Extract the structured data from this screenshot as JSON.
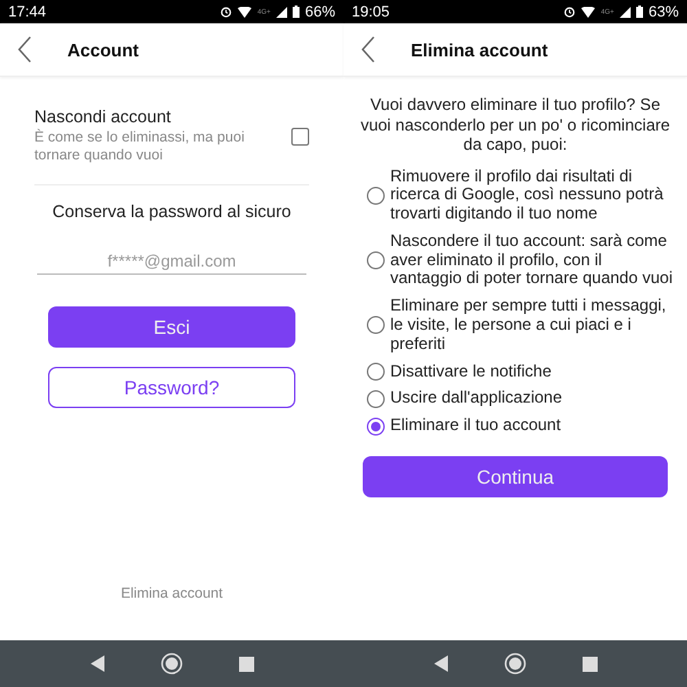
{
  "screens": [
    {
      "kind": "account",
      "status": {
        "time": "17:44",
        "network": "4G+",
        "battery": "66%"
      },
      "title": "Account",
      "hide_option": {
        "label": "Nascondi account",
        "description": "È come se lo eliminassi, ma puoi tornare quando vuoi",
        "checked": false
      },
      "password_note": "Conserva la password al sicuro",
      "email_field": {
        "value": "f*****@gmail.com"
      },
      "buttons": [
        {
          "label": "Esci",
          "kind": "primary"
        },
        {
          "label": "Password?",
          "kind": "outline"
        }
      ],
      "footer_link": "Elimina account"
    },
    {
      "kind": "delete",
      "status": {
        "time": "19:05",
        "network": "4G+",
        "battery": "63%"
      },
      "title": "Elimina account",
      "intro": "Vuoi davvero eliminare il tuo profilo? Se vuoi nasconderlo per un po' o ricominciare da capo, puoi:",
      "options": [
        {
          "label": "Rimuovere il profilo dai risultati di ricerca di Google, così nessuno potrà trovarti digitando il tuo nome",
          "selected": false
        },
        {
          "label": "Nascondere il tuo account: sarà come aver eliminato il profilo, con il vantaggio di poter tornare quando vuoi",
          "selected": false
        },
        {
          "label": "Eliminare per sempre tutti i messaggi, le visite, le persone a cui piaci e i preferiti",
          "selected": false
        },
        {
          "label": "Disattivare le notifiche",
          "selected": false
        },
        {
          "label": "Uscire dall'applicazione",
          "selected": false
        },
        {
          "label": "Eliminare il tuo account",
          "selected": true
        }
      ],
      "buttons": [
        {
          "label": "Continua",
          "kind": "primary"
        }
      ]
    }
  ]
}
